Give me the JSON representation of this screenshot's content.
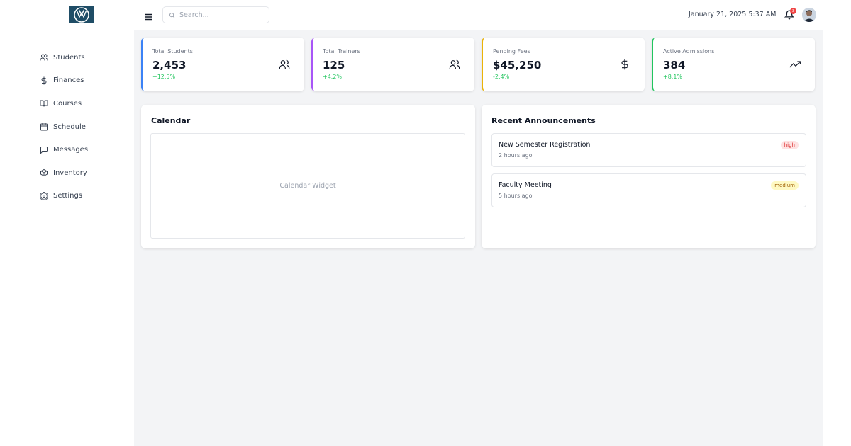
{
  "sidebar": {
    "items": [
      {
        "label": "Students",
        "icon": "users-icon"
      },
      {
        "label": "Finances",
        "icon": "dollar-icon"
      },
      {
        "label": "Courses",
        "icon": "book-icon"
      },
      {
        "label": "Schedule",
        "icon": "calendar-icon"
      },
      {
        "label": "Messages",
        "icon": "message-icon"
      },
      {
        "label": "Inventory",
        "icon": "box-icon"
      },
      {
        "label": "Settings",
        "icon": "gear-icon"
      }
    ]
  },
  "header": {
    "search_placeholder": "Search...",
    "datetime": "January 21, 2025 5:37 AM",
    "notification_count": "3"
  },
  "stats": [
    {
      "label": "Total Students",
      "value": "2,453",
      "change": "+12.5%",
      "accent": "#3b82f6",
      "change_color": "#22c55e",
      "icon": "users-icon"
    },
    {
      "label": "Total Trainers",
      "value": "125",
      "change": "+4.2%",
      "accent": "#a855f7",
      "change_color": "#22c55e",
      "icon": "users-icon"
    },
    {
      "label": "Pending Fees",
      "value": "$45,250",
      "change": "-2.4%",
      "accent": "#eab308",
      "change_color": "#22c55e",
      "icon": "dollar-icon"
    },
    {
      "label": "Active Admissions",
      "value": "384",
      "change": "+8.1%",
      "accent": "#22c55e",
      "change_color": "#22c55e",
      "icon": "trending-up-icon"
    }
  ],
  "calendar": {
    "title": "Calendar",
    "placeholder": "Calendar Widget"
  },
  "announcements": {
    "title": "Recent Announcements",
    "items": [
      {
        "title": "New Semester Registration",
        "time": "2 hours ago",
        "priority": "high",
        "badge_bg": "#fee2e2",
        "badge_color": "#dc2626"
      },
      {
        "title": "Faculty Meeting",
        "time": "5 hours ago",
        "priority": "medium",
        "badge_bg": "#fef9c3",
        "badge_color": "#a16207"
      }
    ]
  }
}
